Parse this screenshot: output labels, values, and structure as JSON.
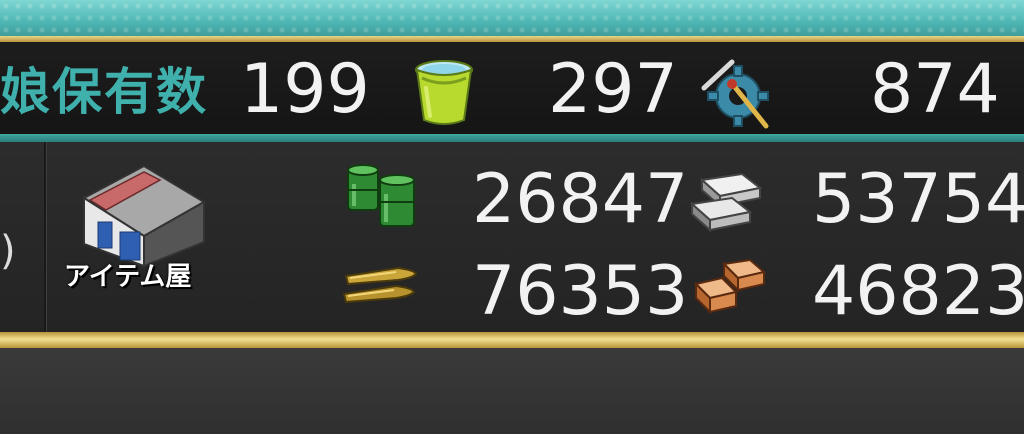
{
  "top_bar": {
    "ship_count_label": "娘保有数",
    "ship_count": "199",
    "bucket_count": "297",
    "dev_material_count": "874",
    "icons": [
      "bucket-icon",
      "development-material-icon"
    ]
  },
  "resources": {
    "fuel": "26847",
    "steel": "53754",
    "ammo": "76353",
    "bauxite": "46823",
    "icons": [
      "fuel-icon",
      "steel-icon",
      "ammo-icon",
      "bauxite-icon"
    ]
  },
  "shop": {
    "label": "アイテム屋",
    "left_fragment": ")"
  }
}
